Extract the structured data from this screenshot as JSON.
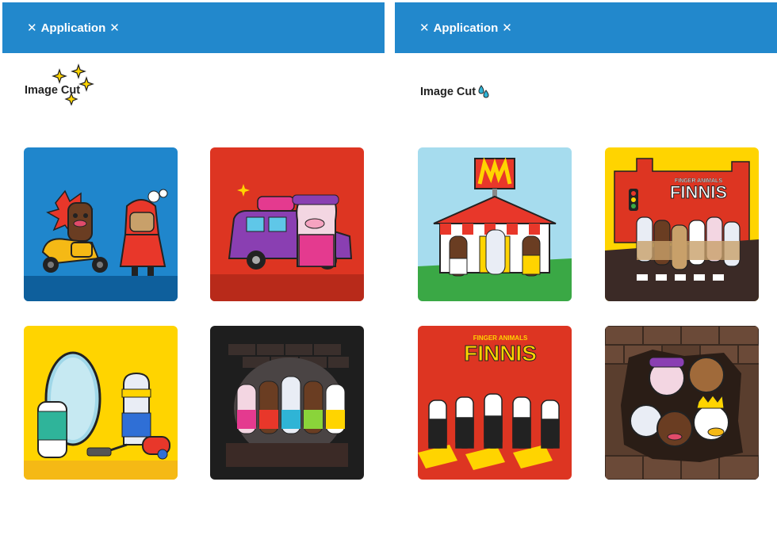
{
  "panels": [
    {
      "header": {
        "title": "Application",
        "close_icon_left": "close-icon",
        "close_icon_right": "close-icon"
      },
      "section_title": "Image Cut",
      "section_icon": "sparkle-icon",
      "images": [
        {
          "name": "scooter-scene",
          "bg": "#1f86cc"
        },
        {
          "name": "purple-van-scene",
          "bg": "#dd3522"
        },
        {
          "name": "mirror-vacuum-scene",
          "bg": "#ffd400"
        },
        {
          "name": "band-spotlight-scene",
          "bg": "#1e1e1e"
        }
      ]
    },
    {
      "header": {
        "title": "Application",
        "close_icon_left": "close-icon",
        "close_icon_right": "close-icon"
      },
      "section_title": "Image Cut",
      "section_icon": "drops-icon",
      "images": [
        {
          "name": "fastfood-restaurant-scene",
          "bg": "#a6dcee"
        },
        {
          "name": "finnis-crosswalk-scene",
          "bg": "#ffd400",
          "logo_text": "FINNIS",
          "logo_sub": "FINGER ANIMALS"
        },
        {
          "name": "finnis-abbey-road-scene",
          "bg": "#dd3522",
          "logo_text": "FINNIS",
          "logo_sub": "FINGER ANIMALS"
        },
        {
          "name": "brick-wall-breakout-scene",
          "bg": "#5a3e2e"
        }
      ]
    }
  ]
}
